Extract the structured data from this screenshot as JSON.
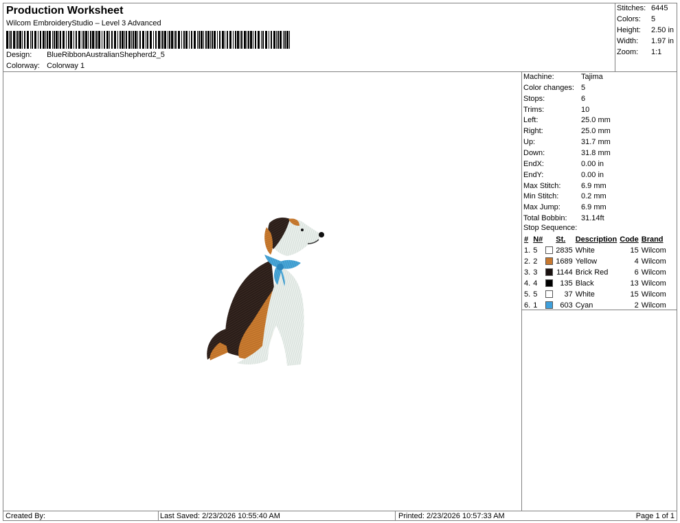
{
  "header": {
    "title": "Production Worksheet",
    "subtitle": "Wilcom EmbroideryStudio – Level 3 Advanced",
    "design_label": "Design:",
    "design_value": "BlueRibbonAustralianShepherd2_5",
    "colorway_label": "Colorway:",
    "colorway_value": "Colorway 1"
  },
  "stats": [
    {
      "label": "Stitches:",
      "value": "6445"
    },
    {
      "label": "Colors:",
      "value": "5"
    },
    {
      "label": "Height:",
      "value": "2.50 in"
    },
    {
      "label": "Width:",
      "value": "1.97 in"
    },
    {
      "label": "Zoom:",
      "value": "1:1"
    }
  ],
  "machine_info": [
    {
      "label": "Machine:",
      "value": "Tajima"
    },
    {
      "label": "Color changes:",
      "value": "5"
    },
    {
      "label": "Stops:",
      "value": "6"
    },
    {
      "label": "Trims:",
      "value": "10"
    },
    {
      "label": "Left:",
      "value": "25.0 mm"
    },
    {
      "label": "Right:",
      "value": "25.0 mm"
    },
    {
      "label": "Up:",
      "value": "31.7 mm"
    },
    {
      "label": "Down:",
      "value": "31.8 mm"
    },
    {
      "label": "EndX:",
      "value": "0.00 in"
    },
    {
      "label": "EndY:",
      "value": "0.00 in"
    },
    {
      "label": "Max Stitch:",
      "value": "6.9 mm"
    },
    {
      "label": "Min Stitch:",
      "value": "0.2 mm"
    },
    {
      "label": "Max Jump:",
      "value": "6.9 mm"
    },
    {
      "label": "Total Bobbin:",
      "value": "31.14ft"
    }
  ],
  "stop_sequence": {
    "label": "Stop Sequence:",
    "columns": [
      "#",
      "N#",
      "St.",
      "Description",
      "Code",
      "Brand"
    ],
    "rows": [
      {
        "num": "1.",
        "n": "5",
        "color": "#ffffff",
        "st": "2835",
        "desc": "White",
        "code": "15",
        "brand": "Wilcom"
      },
      {
        "num": "2.",
        "n": "2",
        "color": "#c8782e",
        "st": "1689",
        "desc": "Yellow",
        "code": "4",
        "brand": "Wilcom"
      },
      {
        "num": "3.",
        "n": "3",
        "color": "#1a1210",
        "st": "1144",
        "desc": "Brick Red",
        "code": "6",
        "brand": "Wilcom"
      },
      {
        "num": "4.",
        "n": "4",
        "color": "#000000",
        "st": "135",
        "desc": "Black",
        "code": "13",
        "brand": "Wilcom"
      },
      {
        "num": "5.",
        "n": "5",
        "color": "#ffffff",
        "st": "37",
        "desc": "White",
        "code": "15",
        "brand": "Wilcom"
      },
      {
        "num": "6.",
        "n": "1",
        "color": "#3fa0dc",
        "st": "603",
        "desc": "Cyan",
        "code": "2",
        "brand": "Wilcom"
      }
    ]
  },
  "footer": {
    "created_by": "Created By:",
    "last_saved": "Last Saved: 2/23/2026 10:55:40 AM",
    "printed": "Printed: 2/23/2026 10:57:33 AM",
    "page": "Page 1 of 1"
  }
}
